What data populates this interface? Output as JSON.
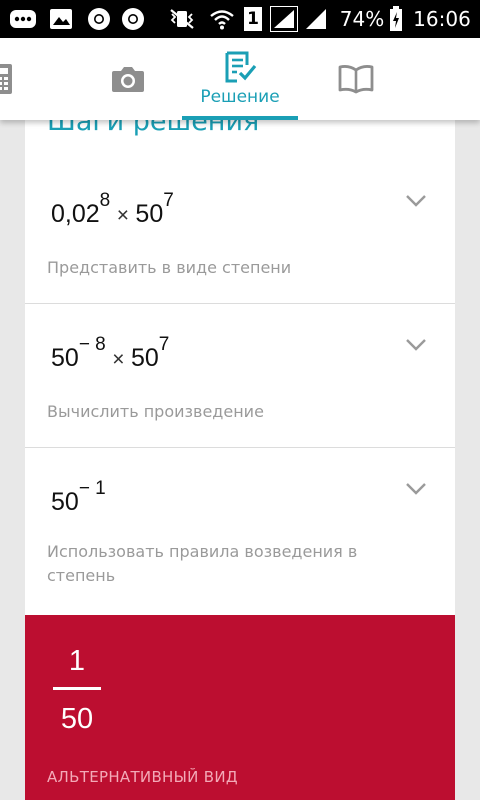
{
  "status_bar": {
    "battery_percent": "74%",
    "time": "16:06",
    "sim_number": "1",
    "icons": [
      "chat-icon",
      "gallery-icon",
      "chrome-icon",
      "chrome-icon",
      "mute-vibrate-icon",
      "wifi-icon",
      "sim1-icon",
      "signal-icon",
      "signal-icon",
      "battery-charging-icon"
    ]
  },
  "tabs": [
    {
      "name": "calculator",
      "icon": "calculator-icon",
      "label": ""
    },
    {
      "name": "camera",
      "icon": "camera-icon",
      "label": ""
    },
    {
      "name": "solution",
      "icon": "solution-icon",
      "label": "Решение",
      "active": true
    },
    {
      "name": "book",
      "icon": "book-icon",
      "label": ""
    }
  ],
  "section": {
    "title": "Шаги решения"
  },
  "steps": [
    {
      "expression": {
        "base1": "0,02",
        "exp1": "8",
        "times": "×",
        "base2": "50",
        "exp2": "7"
      },
      "description": "Представить в виде степени"
    },
    {
      "expression": {
        "base1": "50",
        "exp1": "− 8",
        "times": "×",
        "base2": "50",
        "exp2": "7"
      },
      "description": "Вычислить произведение"
    },
    {
      "expression": {
        "base1": "50",
        "exp1": "− 1"
      },
      "description": "Использовать правила возведения в степень"
    }
  ],
  "answer": {
    "numerator": "1",
    "denominator": "50",
    "alternative_label": "АЛЬТЕРНАТИВНЫЙ ВИД"
  },
  "colors": {
    "accent": "#1a9fb5",
    "answer_bg": "#bc0e30",
    "muted_text": "#9a9a9a",
    "status_bar_bg": "#000000"
  }
}
